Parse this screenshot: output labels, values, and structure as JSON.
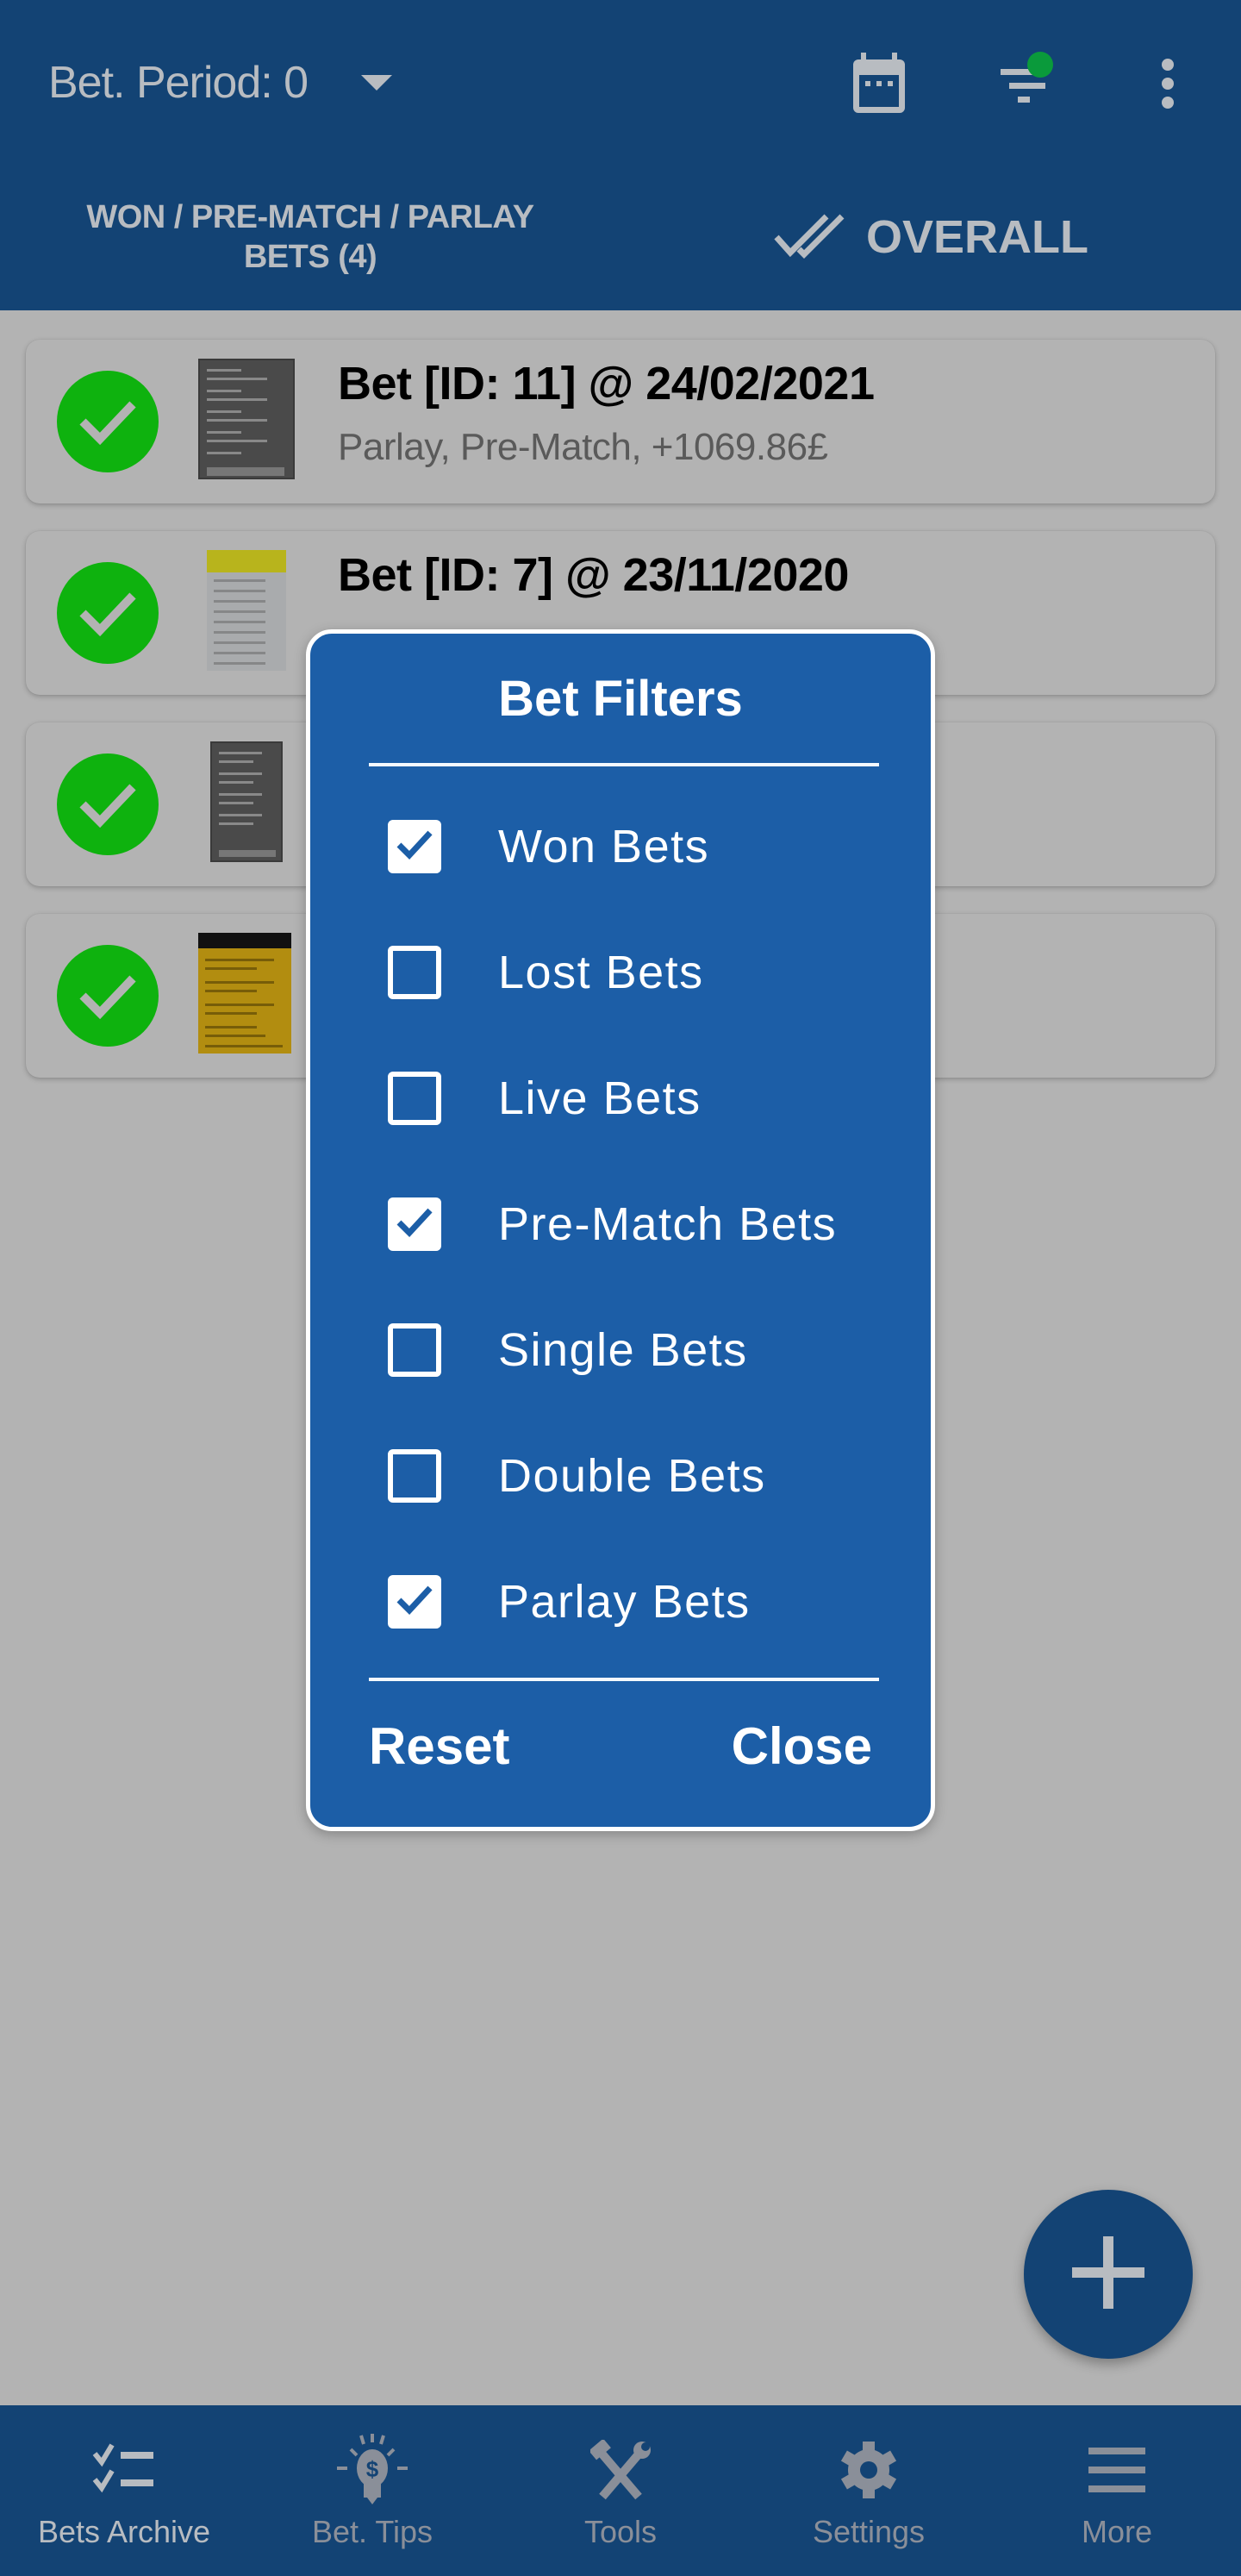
{
  "appbar": {
    "period_label": "Bet. Period: 0",
    "icons": [
      "calendar-icon",
      "filter-icon",
      "more-vert-icon"
    ],
    "filter_active_indicator_color": "#0a9a3b"
  },
  "tabs": [
    {
      "label": "WON / PRE-MATCH / PARLAY BETS (4)",
      "active": true
    },
    {
      "label": "OVERALL",
      "icon": "double-check-icon",
      "active": false
    }
  ],
  "bets": [
    {
      "title": "Bet [ID: 11] @ 24/02/2021",
      "subtitle": "Parlay, Pre-Match, +1069.86£",
      "status": "won",
      "thumbnail": "dark"
    },
    {
      "title": "Bet [ID: 7] @ 23/11/2020",
      "subtitle": "",
      "status": "won",
      "thumbnail": "light"
    },
    {
      "title": "",
      "subtitle": "",
      "status": "won",
      "thumbnail": "dark"
    },
    {
      "title": "",
      "subtitle": "",
      "status": "won",
      "thumbnail": "yellow"
    }
  ],
  "dialog": {
    "title": "Bet Filters",
    "filters": [
      {
        "label": "Won Bets",
        "checked": true
      },
      {
        "label": "Lost Bets",
        "checked": false
      },
      {
        "label": "Live Bets",
        "checked": false
      },
      {
        "label": "Pre-Match Bets",
        "checked": true
      },
      {
        "label": "Single Bets",
        "checked": false
      },
      {
        "label": "Double Bets",
        "checked": false
      },
      {
        "label": "Parlay Bets",
        "checked": true
      }
    ],
    "reset_label": "Reset",
    "close_label": "Close"
  },
  "fab": {
    "icon": "plus-icon"
  },
  "bottom_nav": [
    {
      "label": "Bets Archive",
      "icon": "checklist-icon",
      "active": true
    },
    {
      "label": "Bet. Tips",
      "icon": "lightbulb-dollar-icon",
      "active": false
    },
    {
      "label": "Tools",
      "icon": "tools-icon",
      "active": false
    },
    {
      "label": "Settings",
      "icon": "gear-icon",
      "active": false
    },
    {
      "label": "More",
      "icon": "menu-icon",
      "active": false
    }
  ],
  "colors": {
    "primary": "#134374",
    "dialog": "#1c5ea7",
    "won_green": "#0eb20e",
    "scrim_background": "#b3b3b3"
  }
}
